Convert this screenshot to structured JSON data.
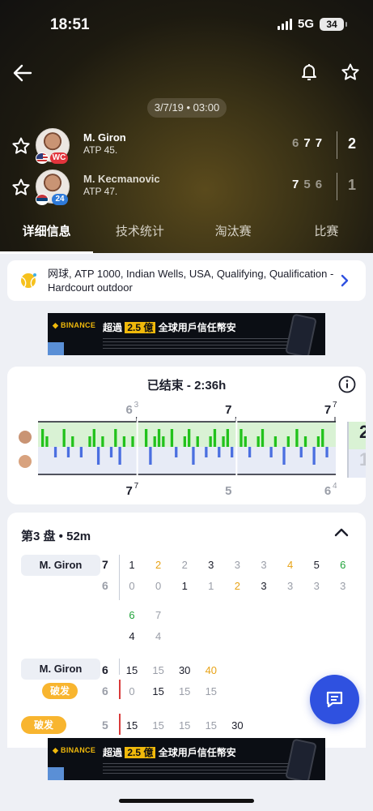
{
  "status_bar": {
    "time": "18:51",
    "network": "5G",
    "battery": "34"
  },
  "match": {
    "date": "3/7/19 • 03:00",
    "players": [
      {
        "name": "M. Giron",
        "rank": "ATP 45.",
        "badge": "WC",
        "sets": [
          "6",
          "7",
          "7"
        ],
        "set_wins": [
          false,
          true,
          true
        ],
        "total": "2",
        "winner": true
      },
      {
        "name": "M. Kecmanovic",
        "rank": "ATP 47.",
        "badge": "24",
        "sets": [
          "7",
          "5",
          "6"
        ],
        "set_wins": [
          true,
          false,
          false
        ],
        "total": "1",
        "winner": false
      }
    ]
  },
  "tabs": [
    "详细信息",
    "技术统计",
    "淘汰赛",
    "比赛"
  ],
  "competition": {
    "text": "网球, ATP 1000, Indian Wells, USA, Qualifying, Qualification - Hardcourt outdoor"
  },
  "ad": {
    "brand": "◆ BINANCE",
    "headline_pre": "超過",
    "headline_highlight": "2.5 億",
    "headline_post": "全球用戶信任幣安"
  },
  "momentum": {
    "status": "已结束 - 2:36h",
    "set_scores_top": [
      "6",
      "7",
      "7"
    ],
    "set_scores_top_tb": [
      "3",
      "",
      "7"
    ],
    "set_scores_bottom": [
      "7",
      "5",
      "6"
    ],
    "set_scores_bottom_tb": [
      "7",
      "",
      "4"
    ],
    "side_top": "2",
    "side_bottom": "1",
    "bars": [
      [
        2,
        1,
        0,
        -1,
        0,
        2,
        -1,
        1,
        0,
        -1,
        0,
        1,
        2,
        -2,
        1,
        0,
        -1,
        2,
        -2,
        1,
        0,
        1
      ],
      [
        0,
        2,
        -2,
        1,
        2,
        1,
        0,
        2,
        -1,
        0,
        1,
        2,
        -2,
        1,
        0,
        -1,
        1,
        2,
        -1,
        1,
        2,
        -1
      ],
      [
        2,
        1,
        -1,
        0,
        1,
        2,
        0,
        -1,
        1,
        0,
        -2,
        1,
        0,
        2,
        -1,
        1,
        0,
        -2,
        1,
        2,
        -1,
        0
      ]
    ]
  },
  "set_detail": {
    "title": "第3 盘 • 52m",
    "game_row": {
      "player_label": "M. Giron",
      "score_top": "7",
      "score_bottom": "6",
      "top": [
        "1",
        "2",
        "2",
        "3",
        "3",
        "3",
        "4",
        "5",
        "6",
        "6",
        "7"
      ],
      "top_colors": [
        "#1b1d2a",
        "#e8a317",
        "#9a9ea8",
        "#1b1d2a",
        "#9a9ea8",
        "#9a9ea8",
        "#e8a317",
        "#1b1d2a",
        "#21a33a",
        "#21a33a",
        "#9a9ea8"
      ],
      "bottom": [
        "0",
        "0",
        "1",
        "1",
        "2",
        "3",
        "3",
        "3",
        "3",
        "4",
        "4"
      ],
      "bottom_colors": [
        "#9a9ea8",
        "#9a9ea8",
        "#1b1d2a",
        "#9a9ea8",
        "#e8a317",
        "#1b1d2a",
        "#9a9ea8",
        "#9a9ea8",
        "#9a9ea8",
        "#1b1d2a",
        "#9a9ea8"
      ]
    },
    "point_row_1": {
      "player_label": "M. Giron",
      "break_label": "破发",
      "score_top": "6",
      "score_bottom": "6",
      "top": [
        "15",
        "15",
        "30",
        "40"
      ],
      "top_colors": [
        "#1b1d2a",
        "#9a9ea8",
        "#1b1d2a",
        "#e8a317"
      ],
      "bottom": [
        "0",
        "15",
        "15",
        "15"
      ],
      "bottom_colors": [
        "#9a9ea8",
        "#1b1d2a",
        "#9a9ea8",
        "#9a9ea8"
      ]
    },
    "point_row_2": {
      "break_label": "破发",
      "score_top": "5",
      "top": [
        "15",
        "15",
        "15",
        "15",
        "30"
      ],
      "top_colors": [
        "#1b1d2a",
        "#9a9ea8",
        "#9a9ea8",
        "#9a9ea8",
        "#1b1d2a"
      ]
    }
  },
  "colors": {
    "accent": "#2f51e0",
    "win_green": "#21c21b",
    "lose_blue": "#4b6fe0",
    "break": "#f8b52f"
  }
}
